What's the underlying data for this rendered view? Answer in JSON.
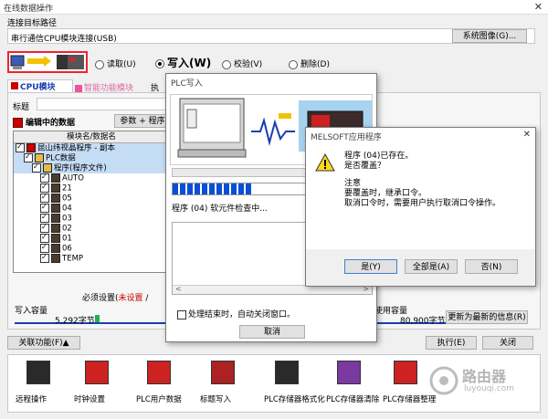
{
  "window": {
    "title": "在线数据操作"
  },
  "connection": {
    "group_label": "连接目标路径",
    "path_value": "串行通信CPU模块连接(USB)",
    "system_image_button": "系统图像(G)..."
  },
  "operations": {
    "read_label": "读取(U)",
    "write_label": "写入(W)",
    "verify_label": "校验(V)",
    "delete_label": "删除(D)",
    "selected": "write"
  },
  "tabs": {
    "cpu_module": "CPU模块",
    "intelligent": "智能功能模块",
    "exec_partial": "执"
  },
  "main": {
    "caption_label": "标题",
    "editing_data_label": "编辑中的数据",
    "param_button_partial": "参数 + 程序",
    "tree_header": "模块名/数据名",
    "tree_items": [
      {
        "label": "昆山纬视晶程序 - 副本",
        "level": 0,
        "type": "project"
      },
      {
        "label": "PLC数据",
        "level": 1,
        "type": "folder"
      },
      {
        "label": "程序(程序文件)",
        "level": 2,
        "type": "folder"
      },
      {
        "label": "AUTO",
        "level": 3,
        "type": "program"
      },
      {
        "label": "21",
        "level": 3,
        "type": "program"
      },
      {
        "label": "05",
        "level": 3,
        "type": "program"
      },
      {
        "label": "04",
        "level": 3,
        "type": "program"
      },
      {
        "label": "03",
        "level": 3,
        "type": "program"
      },
      {
        "label": "02",
        "level": 3,
        "type": "program"
      },
      {
        "label": "01",
        "level": 3,
        "type": "program"
      },
      {
        "label": "06",
        "level": 3,
        "type": "program"
      },
      {
        "label": "TEMP",
        "level": 3,
        "type": "program"
      }
    ],
    "required_setting_label": "必须设置(",
    "not_set_label": "未设置",
    "required_setting_tail": " / ",
    "write_capacity_label": "写入容量",
    "write_capacity_value": "5,292字节",
    "used_capacity_label": "使用容量",
    "used_capacity_value": "80,900字节",
    "refresh_button": "更新为最新的信息(R)",
    "related_function_button": "关联功能(F)▲",
    "execute_button": "执行(E)",
    "close_button": "关闭"
  },
  "functions": [
    {
      "label": "远程操作",
      "icon": "remote-operation-icon"
    },
    {
      "label": "时钟设置",
      "icon": "clock-setting-icon"
    },
    {
      "label": "PLC用户数据",
      "icon": "plc-user-data-icon"
    },
    {
      "label": "标题写入",
      "icon": "title-write-icon"
    },
    {
      "label": "PLC存储器格式化",
      "icon": "plc-memory-format-icon"
    },
    {
      "label": "PLC存储器清除",
      "icon": "plc-memory-clear-icon"
    },
    {
      "label": "PLC存储器整理",
      "icon": "plc-memory-arrange-icon"
    }
  ],
  "plc_write_dialog": {
    "title": "PLC写入",
    "progress_percent": 40,
    "status_text": "程序 (04) 软元件检查中...",
    "auto_close_label": "处理结束时，自动关闭窗口。",
    "cancel_button": "取消"
  },
  "confirm_dialog": {
    "title": "MELSOFT应用程序",
    "message_line1": "程序 (04)已存在。",
    "message_line2": "是否覆盖？",
    "note_label": "注意",
    "note_line1": "要覆盖时，继承口令。",
    "note_line2": "取消口令时，需要用户执行取消口令操作。",
    "yes_button": "是(Y)",
    "yes_all_button": "全部是(A)",
    "no_button": "否(N)"
  },
  "colors": {
    "accent_red": "#cc0000",
    "progress_blue": "#0a4fd4",
    "tree_selected": "#c5dcf5",
    "warning_yellow": "#f7d81e",
    "capacity_green": "#22b14c"
  },
  "watermark": {
    "main": "路由器",
    "sub": "luyouqi.com"
  }
}
